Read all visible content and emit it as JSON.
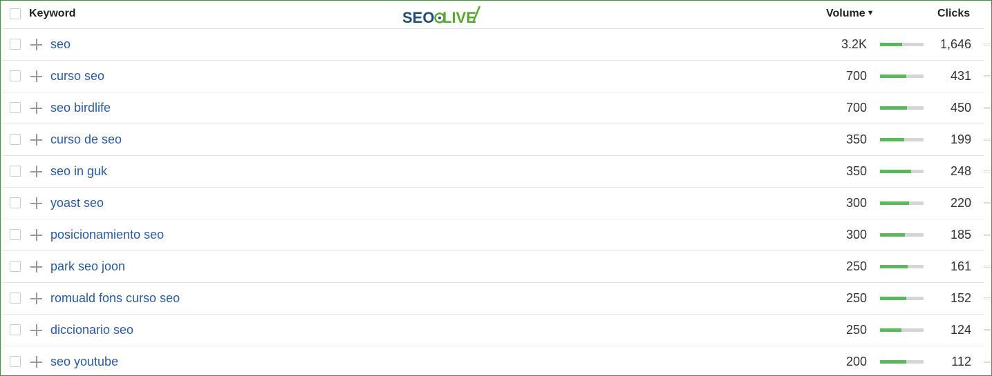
{
  "header": {
    "keyword_label": "Keyword",
    "volume_label": "Volume",
    "sort_caret": "▼",
    "clicks_label": "Clicks"
  },
  "logo": {
    "part1": "SEO",
    "part2": "LIVE",
    "colors": {
      "dark": "#1f4e79",
      "green": "#5aa832"
    }
  },
  "colors": {
    "link": "#2c5aa0",
    "bar_fill": "#5cb85c",
    "bar_track": "#d5d5d5",
    "frame": "#3f8f3f"
  },
  "rows": [
    {
      "keyword": "seo",
      "volume": "3.2K",
      "volume_fill": 0.5,
      "clicks": "1,646"
    },
    {
      "keyword": "curso seo",
      "volume": "700",
      "volume_fill": 0.6,
      "clicks": "431"
    },
    {
      "keyword": "seo birdlife",
      "volume": "700",
      "volume_fill": 0.62,
      "clicks": "450"
    },
    {
      "keyword": "curso de seo",
      "volume": "350",
      "volume_fill": 0.55,
      "clicks": "199"
    },
    {
      "keyword": "seo in guk",
      "volume": "350",
      "volume_fill": 0.72,
      "clicks": "248"
    },
    {
      "keyword": "yoast seo",
      "volume": "300",
      "volume_fill": 0.67,
      "clicks": "220"
    },
    {
      "keyword": "posicionamiento seo",
      "volume": "300",
      "volume_fill": 0.57,
      "clicks": "185"
    },
    {
      "keyword": "park seo joon",
      "volume": "250",
      "volume_fill": 0.64,
      "clicks": "161"
    },
    {
      "keyword": "romuald fons curso seo",
      "volume": "250",
      "volume_fill": 0.61,
      "clicks": "152"
    },
    {
      "keyword": "diccionario seo",
      "volume": "250",
      "volume_fill": 0.49,
      "clicks": "124"
    },
    {
      "keyword": "seo youtube",
      "volume": "200",
      "volume_fill": 0.61,
      "clicks": "112"
    }
  ]
}
